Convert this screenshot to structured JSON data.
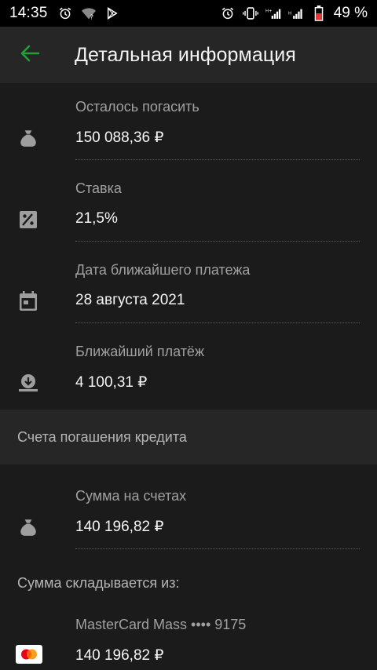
{
  "status_bar": {
    "time": "14:35",
    "battery": "49 %",
    "icons": [
      "alarm-icon",
      "wifi-question-icon",
      "play-store-icon",
      "alarm-icon",
      "vibrate-icon",
      "signal-h-plus-icon",
      "signal-h-icon",
      "battery-icon"
    ]
  },
  "header": {
    "title": "Детальная информация",
    "back_icon": "arrow-left-icon",
    "accent_color": "#21a038"
  },
  "details": [
    {
      "label": "Осталось погасить",
      "value": "150 088,36 ₽",
      "icon": "money-bag-icon"
    },
    {
      "label": "Ставка",
      "value": "21,5%",
      "icon": "percent-icon"
    },
    {
      "label": "Дата ближайшего платежа",
      "value": "28 августа 2021",
      "icon": "calendar-icon"
    },
    {
      "label": "Ближайший платёж",
      "value": "4 100,31 ₽",
      "icon": "download-tray-icon"
    }
  ],
  "accounts_section": {
    "title": "Счета погашения кредита",
    "total": {
      "label": "Сумма на счетах",
      "value": "140 196,82 ₽",
      "icon": "money-bag-icon"
    },
    "breakdown_title": "Сумма складывается из:",
    "cards": [
      {
        "label": "MasterCard Mass •••• 9175",
        "value": "140 196,82 ₽",
        "icon": "mastercard-icon"
      }
    ]
  }
}
